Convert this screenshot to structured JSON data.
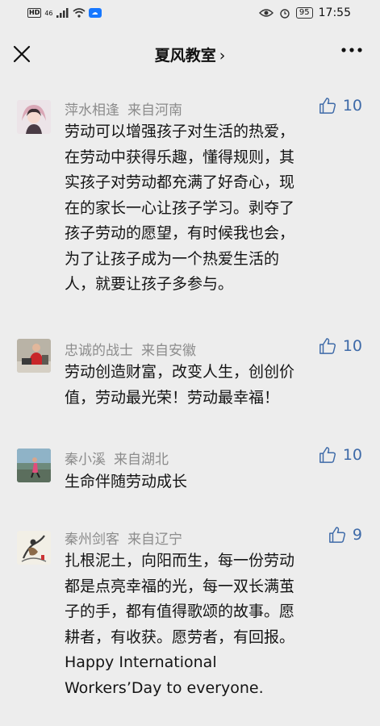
{
  "status_bar": {
    "hd": "HD",
    "signal": "46",
    "battery": "95",
    "time": "17:55"
  },
  "header": {
    "title": "夏风教室",
    "chevron": "›"
  },
  "comments": [
    {
      "name": "萍水相逢",
      "location": "来自河南",
      "likes": "10",
      "avatar": "woman-portrait",
      "lines": [
        "劳动可以增强孩子对生活的热爱，",
        "在劳动中获得乐趣，懂得规则，其",
        "实孩子对劳动都充满了好奇心，现",
        "在的家长一心让孩子学习。剥夺了",
        "孩子劳动的愿望，有时候我也会，",
        "为了让孩子成为一个热爱生活的",
        "人，就要让孩子多参与。"
      ]
    },
    {
      "name": "忠诚的战士",
      "location": "来自安徽",
      "likes": "10",
      "avatar": "man-in-red",
      "lines": [
        "劳动创造财富，改变人生，创创价",
        "值，劳动最光荣！劳动最幸福！"
      ]
    },
    {
      "name": "秦小溪",
      "location": "来自湖北",
      "likes": "10",
      "avatar": "runner-outdoor",
      "lines": [
        "生命伴随劳动成长"
      ]
    },
    {
      "name": "秦州剑客",
      "location": "来自辽宁",
      "likes": "9",
      "avatar": "ink-painting",
      "lines": [
        "扎根泥土，向阳而生，每一份劳动",
        "都是点亮幸福的光，每一双长满茧",
        "子的手，都有值得歌颂的故事。愿",
        "耕者，有收获。愿劳者，有回报。",
        "Happy International",
        "Workers’Day to everyone."
      ]
    }
  ]
}
